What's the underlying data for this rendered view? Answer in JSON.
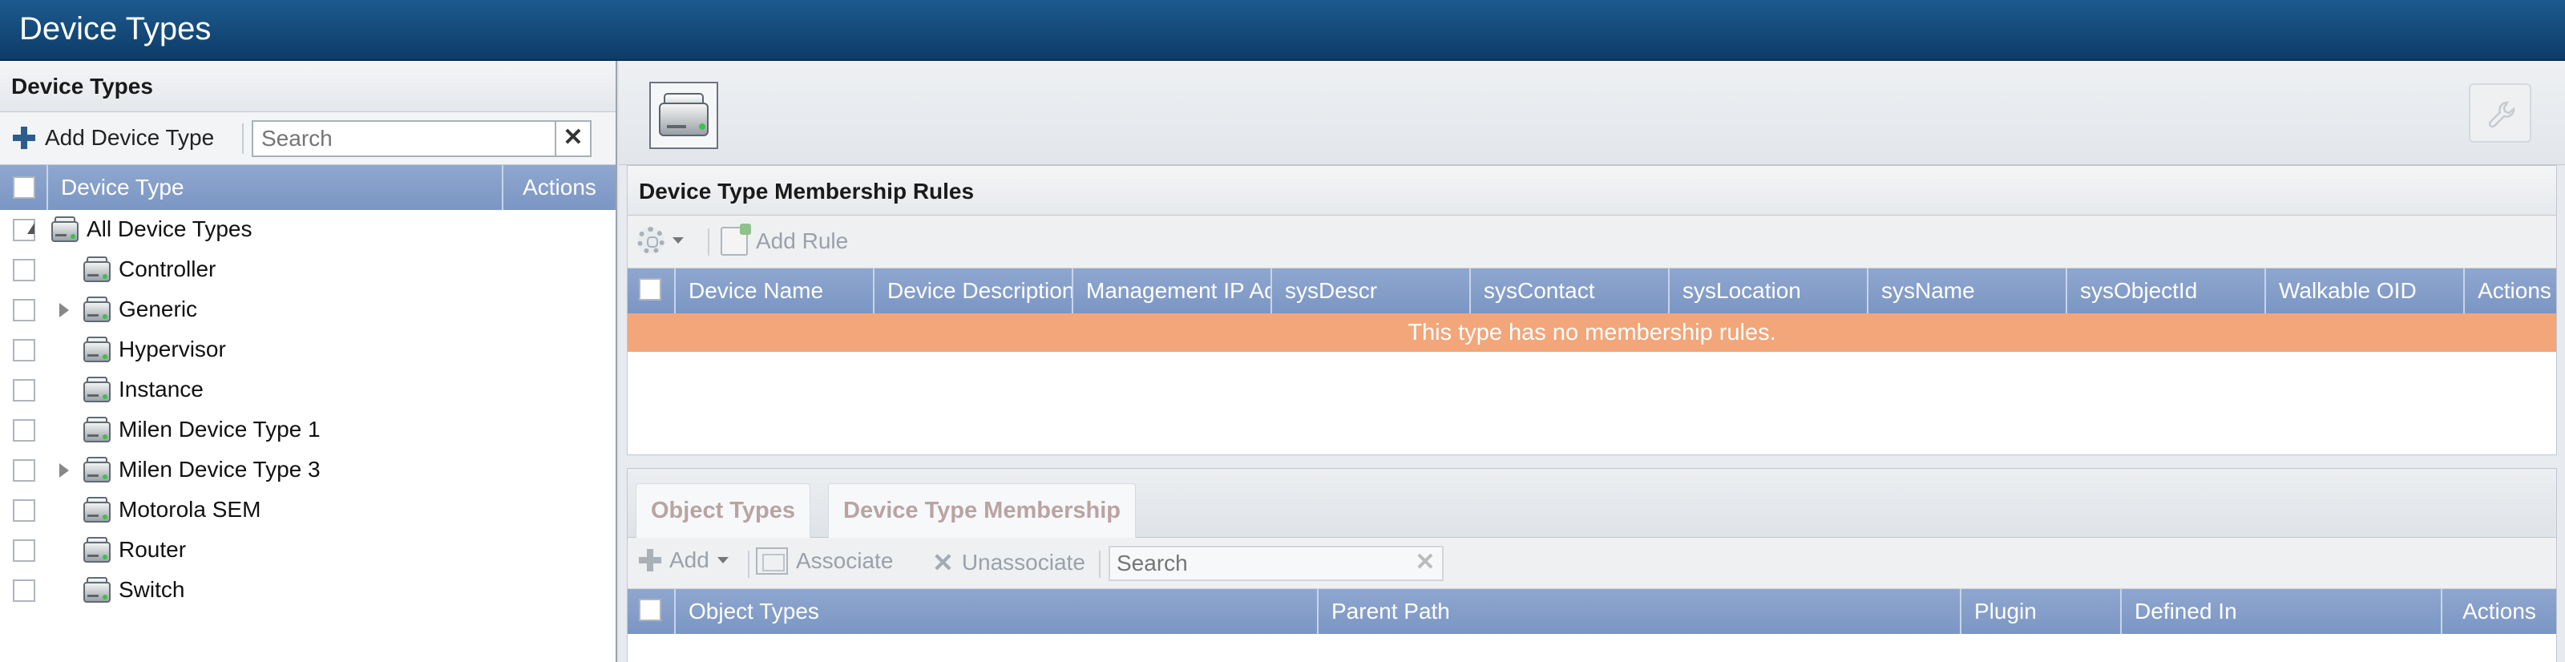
{
  "app": {
    "title": "Device Types"
  },
  "left_panel": {
    "title": "Device Types",
    "add_button": "Add Device Type",
    "search": {
      "placeholder": "Search",
      "value": ""
    },
    "columns": {
      "device_type": "Device Type",
      "actions": "Actions"
    },
    "tree": [
      {
        "label": "All Device Types",
        "level": 0,
        "toggle": "expanded",
        "icon": "device-icon"
      },
      {
        "label": "Controller",
        "level": 1,
        "toggle": "none",
        "icon": "device-icon"
      },
      {
        "label": "Generic",
        "level": 1,
        "toggle": "collapsed",
        "icon": "device-icon"
      },
      {
        "label": "Hypervisor",
        "level": 1,
        "toggle": "none",
        "icon": "device-icon"
      },
      {
        "label": "Instance",
        "level": 1,
        "toggle": "none",
        "icon": "device-icon"
      },
      {
        "label": "Milen Device Type 1",
        "level": 1,
        "toggle": "none",
        "icon": "device-icon"
      },
      {
        "label": "Milen Device Type 3",
        "level": 1,
        "toggle": "collapsed",
        "icon": "device-icon"
      },
      {
        "label": "Motorola SEM",
        "level": 1,
        "toggle": "none",
        "icon": "device-icon"
      },
      {
        "label": "Router",
        "level": 1,
        "toggle": "none",
        "icon": "device-icon"
      },
      {
        "label": "Switch",
        "level": 1,
        "toggle": "none",
        "icon": "device-icon"
      }
    ]
  },
  "rules_panel": {
    "title": "Device Type Membership Rules",
    "toolbar": {
      "settings_icon": "gear-icon",
      "add_rule": "Add Rule"
    },
    "columns": [
      "Device Name",
      "Device Description",
      "Management IP Ad",
      "sysDescr",
      "sysContact",
      "sysLocation",
      "sysName",
      "sysObjectId",
      "Walkable OID",
      "Actions"
    ],
    "empty_message": "This type has no membership rules."
  },
  "bottom_panel": {
    "tabs": [
      "Object Types",
      "Device Type Membership"
    ],
    "toolbar": {
      "add": "Add",
      "associate": "Associate",
      "unassociate": "Unassociate",
      "search_placeholder": "Search"
    },
    "columns": [
      "Object Types",
      "Parent Path",
      "Plugin",
      "Defined In",
      "Actions"
    ]
  },
  "colors": {
    "title_bar": "#0d3c68",
    "grid_header": "#7b96c4",
    "notice": "#f2a67a"
  }
}
